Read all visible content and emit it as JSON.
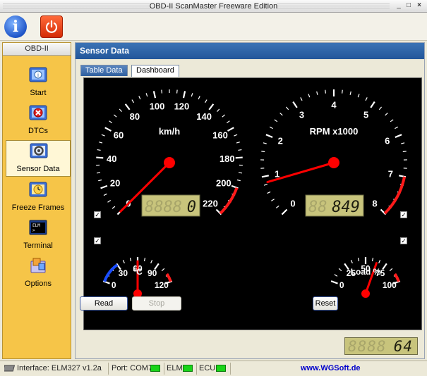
{
  "window": {
    "title": "OBD-II ScanMaster Freeware Edition",
    "controls": [
      "minimize",
      "maximize",
      "close"
    ]
  },
  "toolbar": {
    "buttons": [
      {
        "icon": "info-icon"
      },
      {
        "icon": "power-icon"
      }
    ]
  },
  "sidebar": {
    "header": "OBD-II",
    "items": [
      {
        "label": "Start",
        "icon": "start-icon"
      },
      {
        "label": "DTCs",
        "icon": "dtc-icon"
      },
      {
        "label": "Sensor Data",
        "icon": "sensor-icon",
        "active": true
      },
      {
        "label": "Freeze Frames",
        "icon": "freeze-frames-icon"
      },
      {
        "label": "Terminal",
        "icon": "terminal-icon",
        "icon_text": "ELM\n>"
      },
      {
        "label": "Options",
        "icon": "options-icon"
      }
    ]
  },
  "main": {
    "header": "Sensor Data",
    "tabs": [
      {
        "label": "Table Data",
        "active": false
      },
      {
        "label": "Dashboard",
        "active": true
      }
    ],
    "gauges": {
      "speed": {
        "unit": "km/h",
        "ticks": [
          "0",
          "20",
          "40",
          "60",
          "80",
          "100",
          "120",
          "140",
          "160",
          "180",
          "200",
          "220"
        ],
        "lcd": "0",
        "lcd_ghost": "8888",
        "needle_value": 0
      },
      "rpm": {
        "unit": "RPM x1000",
        "ticks": [
          "0",
          "1",
          "2",
          "3",
          "4",
          "5",
          "6",
          "7",
          "8"
        ],
        "lcd": "849",
        "lcd_ghost": "88",
        "needle_value": 0.849
      },
      "temp": {
        "unit": "°C",
        "ticks": [
          "0",
          "30",
          "60",
          "90",
          "120"
        ],
        "needle_value": 60
      },
      "load": {
        "unit": "Load %",
        "ticks": [
          "0",
          "25",
          "50",
          "75",
          "100"
        ],
        "needle_value": 64
      }
    },
    "checkboxes_checked": [
      true,
      true,
      true,
      true
    ],
    "buttons": {
      "read": "Read",
      "stop": "Stop",
      "reset": "Reset"
    },
    "load_lcd": {
      "value": "64",
      "ghost": "8888"
    }
  },
  "status": {
    "interface": "Interface: ELM327 v1.2a",
    "port": "Port: COM7",
    "elm": "ELM",
    "ecu": "ECU",
    "website": "www.WGSoft.de"
  },
  "colors": {
    "accent": "#2b63a8",
    "sidebar": "#f6c548",
    "needle": "#ff0000",
    "lcd_bg": "#c8c47c",
    "led": "#18d418"
  }
}
